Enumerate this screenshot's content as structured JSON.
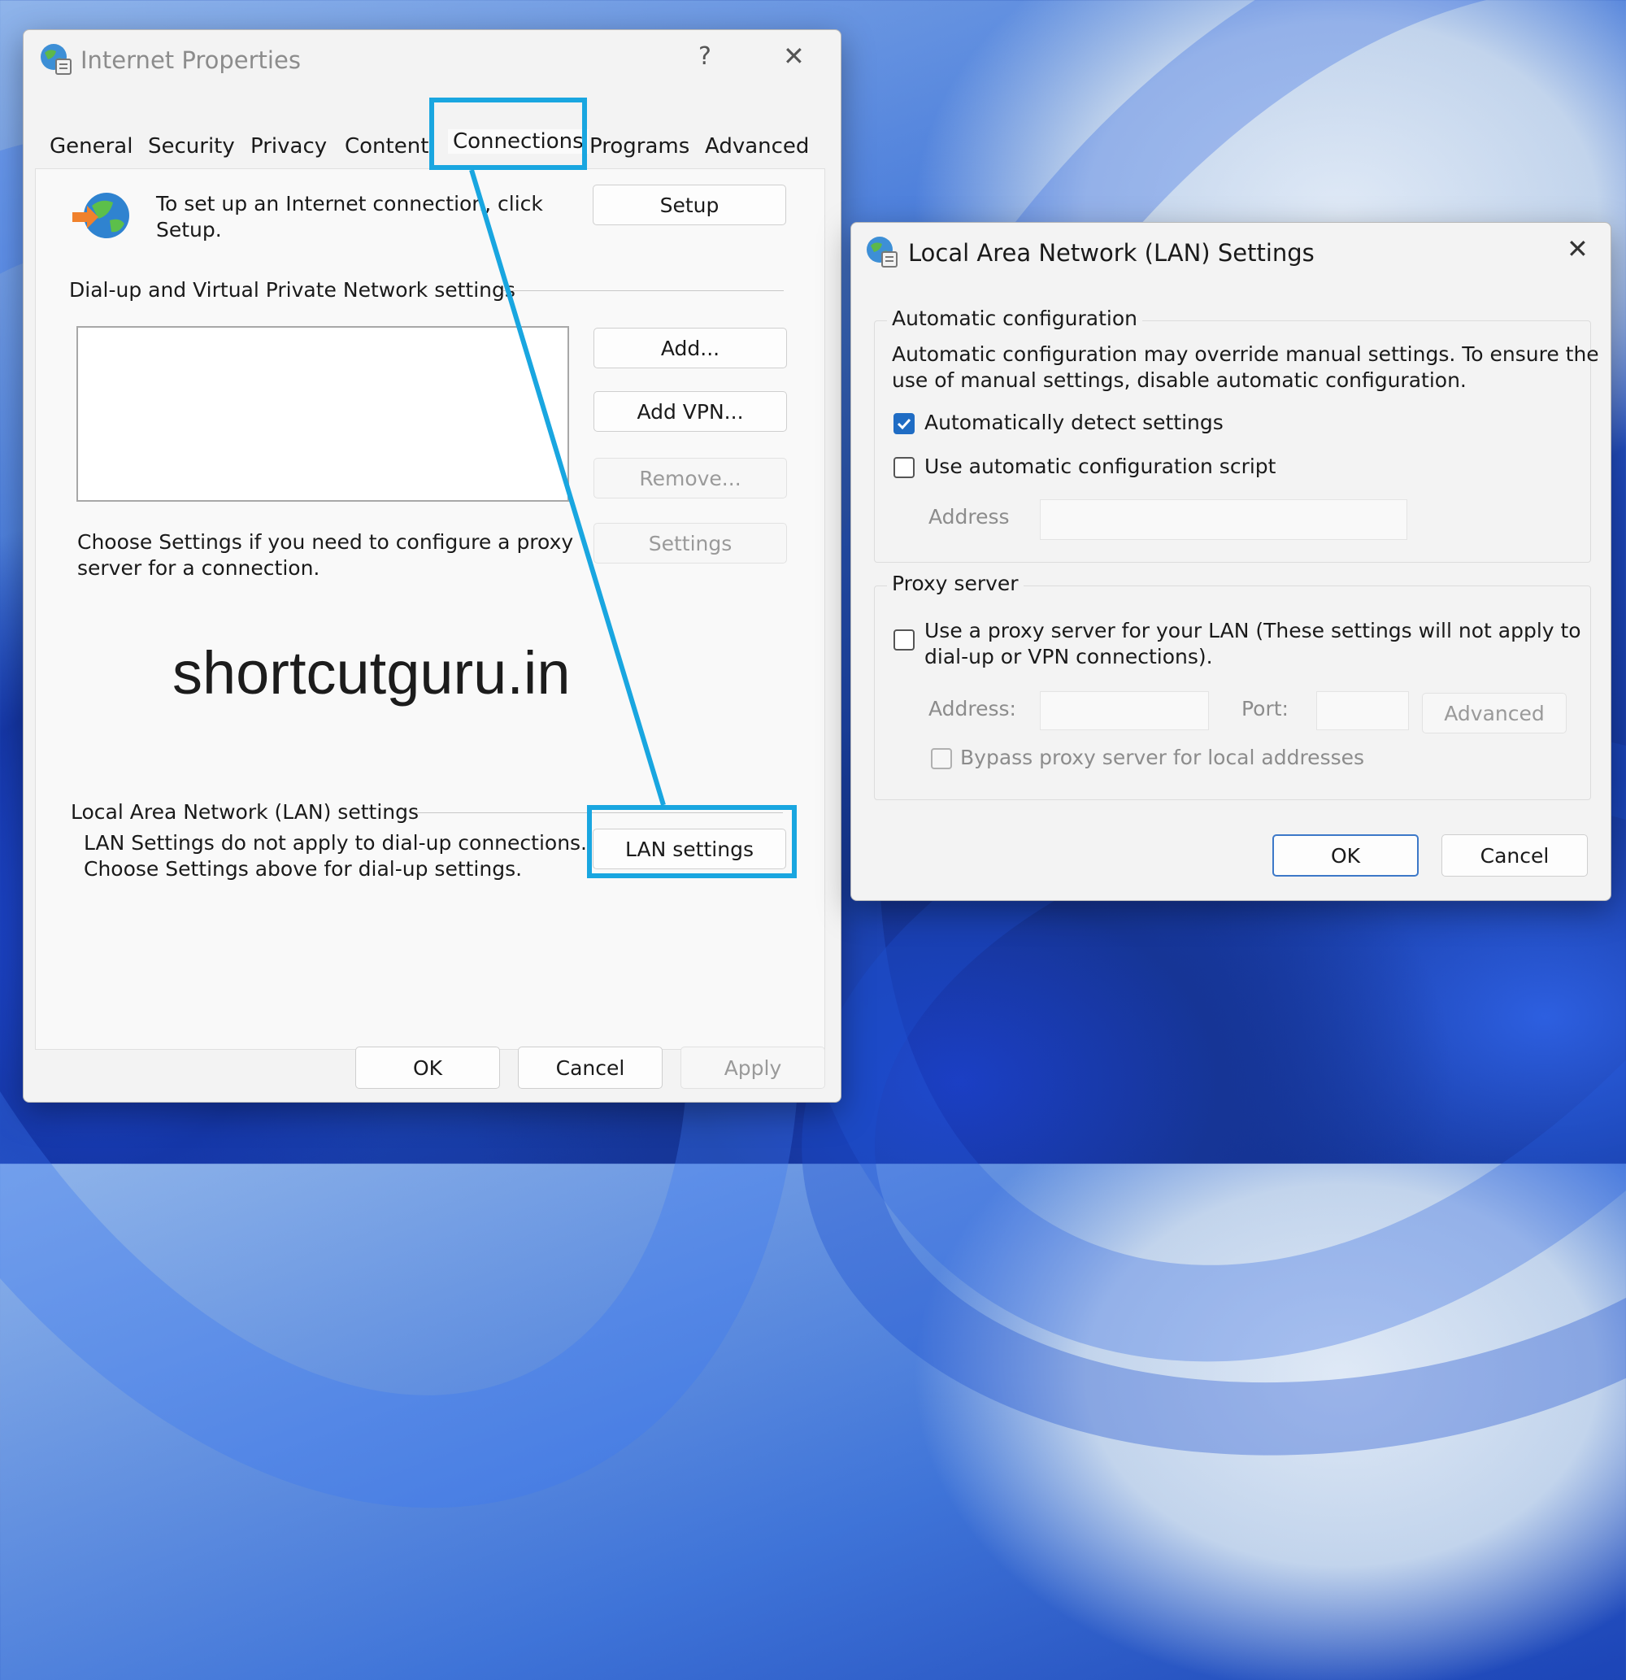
{
  "internet_properties": {
    "title": "Internet Properties",
    "help_glyph": "?",
    "close_glyph": "✕",
    "tabs": [
      "General",
      "Security",
      "Privacy",
      "Content",
      "Connections",
      "Programs",
      "Advanced"
    ],
    "active_tab": "Connections",
    "setup_text_line1": "To set up an Internet connection, click",
    "setup_text_line2": "Setup.",
    "setup_button": "Setup",
    "dialup_section": "Dial-up and Virtual Private Network settings",
    "add_button": "Add...",
    "add_vpn_button": "Add VPN...",
    "remove_button": "Remove...",
    "settings_button": "Settings",
    "proxy_text_line1": "Choose Settings if you need to configure a proxy",
    "proxy_text_line2": "server for a connection.",
    "watermark": "shortcutguru.in",
    "lan_section": "Local Area Network (LAN) settings",
    "lan_text_line1": "LAN Settings do not apply to dial-up connections.",
    "lan_text_line2": "Choose Settings above for dial-up settings.",
    "lan_settings_button": "LAN settings",
    "ok_button": "OK",
    "cancel_button": "Cancel",
    "apply_button": "Apply"
  },
  "lan_dialog": {
    "title": "Local Area Network (LAN) Settings",
    "close_glyph": "✕",
    "auto_config_section": "Automatic configuration",
    "auto_config_text_line1": "Automatic configuration may override manual settings.  To ensure the",
    "auto_config_text_line2": "use of manual settings, disable automatic configuration.",
    "auto_detect_label": "Automatically detect settings",
    "auto_detect_checked": true,
    "auto_script_label": "Use automatic configuration script",
    "auto_script_checked": false,
    "script_address_label": "Address",
    "proxy_section": "Proxy server",
    "proxy_label_line1": "Use a proxy server for your LAN (These settings will not apply to",
    "proxy_label_line2": "dial-up or VPN connections).",
    "proxy_checked": false,
    "proxy_address_label": "Address:",
    "port_label": "Port:",
    "advanced_button": "Advanced",
    "bypass_label": "Bypass proxy server for local addresses",
    "bypass_checked": false,
    "ok_button": "OK",
    "cancel_button": "Cancel"
  },
  "colors": {
    "highlight": "#19a6e0",
    "checkbox_checked": "#1f6cc4",
    "dialog_bg": "#f3f3f3"
  }
}
